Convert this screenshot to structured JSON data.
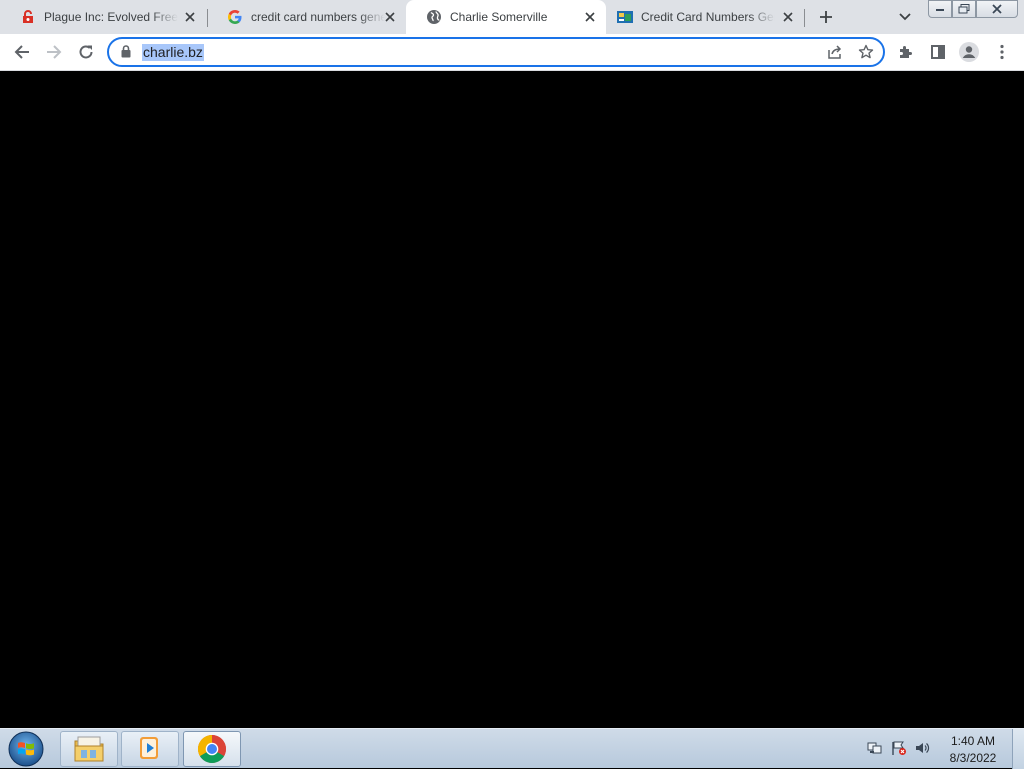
{
  "browser": {
    "tabs": [
      {
        "title": "Plague Inc: Evolved Free Download",
        "favicon": "plague-inc-icon"
      },
      {
        "title": "credit card numbers generator",
        "favicon": "google-icon"
      },
      {
        "title": "Charlie Somerville",
        "favicon": "globe-icon"
      },
      {
        "title": "Credit Card Numbers Generator",
        "favicon": "card-generator-icon"
      }
    ],
    "active_tab_index": 2,
    "address": "charlie.bz"
  },
  "taskbar": {
    "items": [
      "file-explorer",
      "windows-media-player",
      "google-chrome"
    ],
    "clock_time": "1:40 AM",
    "clock_date": "8/3/2022"
  },
  "colors": {
    "accent": "#1a73e8",
    "page_background": "#000000",
    "tab_strip": "#dee1e6"
  }
}
